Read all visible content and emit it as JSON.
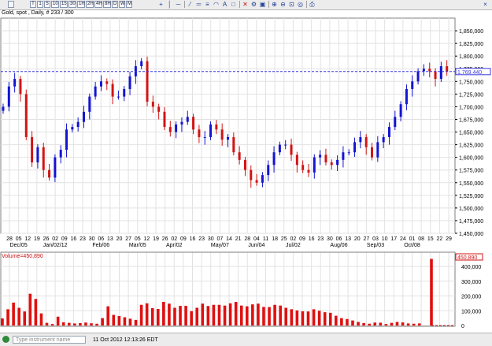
{
  "toolbar": {
    "buttons": [
      "T",
      "1",
      "5",
      "10",
      "15",
      "30",
      "1H",
      "2H",
      "4H",
      "8H",
      "D",
      "W",
      "M"
    ],
    "icons": [
      "crosshair-icon",
      "vertical-line-icon",
      "horizontal-line-icon",
      "trendline-icon",
      "channel-icon",
      "fibonacci-icon",
      "arc-icon",
      "text-icon",
      "rectangle-icon",
      "delete-icon",
      "properties-icon",
      "image-icon",
      "zoom-in-icon",
      "zoom-out-icon",
      "zoom-fit-icon",
      "zoom-reset-icon",
      "print-icon",
      "close-icon"
    ]
  },
  "chart": {
    "title": "Gold, spot , Daily, # 233 / 300",
    "price_label": "1,769.440",
    "volume_label": "Volume=450,890",
    "volume_marker": "450,890"
  },
  "status": {
    "search_placeholder": "Type instrument name",
    "timestamp": "11 Oct 2012 12:13:26 EDT"
  },
  "chart_data": [
    {
      "type": "candlestick",
      "title": "Gold, spot , Daily, # 233 / 300",
      "ylim": [
        1450,
        1875
      ],
      "y_ticks": [
        "1,450,000",
        "1,475,000",
        "1,500,000",
        "1,525,000",
        "1,550,000",
        "1,575,000",
        "1,600,000",
        "1,625,000",
        "1,650,000",
        "1,675,000",
        "1,700,000",
        "1,725,000",
        "1,750,000",
        "1,775,000",
        "1,800,000",
        "1,825,000",
        "1,850,000"
      ],
      "x_ticks": [
        "28",
        "05",
        "12",
        "19",
        "26",
        "02",
        "09",
        "16",
        "23",
        "30",
        "06",
        "13",
        "20",
        "27",
        "05",
        "12",
        "19",
        "26",
        "02",
        "09",
        "16",
        "23",
        "30",
        "07",
        "14",
        "21",
        "28",
        "04",
        "11",
        "18",
        "25",
        "02",
        "09",
        "16",
        "23",
        "30",
        "06",
        "13",
        "20",
        "27",
        "03",
        "10",
        "17",
        "24",
        "01",
        "08",
        "15",
        "22",
        "29"
      ],
      "month_labels": [
        "Dec/05",
        "Jan/02/12",
        "Feb/06",
        "Mar/05",
        "Apr/02",
        "May/07",
        "Jun/04",
        "Jul/02",
        "Aug/06",
        "Sep/03",
        "Oct/08"
      ],
      "reference_line": 1769.44,
      "close_values": [
        1700,
        1740,
        1755,
        1725,
        1640,
        1590,
        1620,
        1575,
        1560,
        1600,
        1615,
        1655,
        1660,
        1670,
        1690,
        1720,
        1740,
        1750,
        1745,
        1720,
        1720,
        1735,
        1760,
        1780,
        1790,
        1710,
        1700,
        1690,
        1660,
        1650,
        1665,
        1670,
        1680,
        1655,
        1640,
        1640,
        1665,
        1655,
        1635,
        1640,
        1610,
        1595,
        1575,
        1555,
        1550,
        1565,
        1585,
        1610,
        1625,
        1625,
        1605,
        1585,
        1575,
        1570,
        1600,
        1605,
        1590,
        1585,
        1595,
        1610,
        1610,
        1630,
        1640,
        1620,
        1600,
        1630,
        1640,
        1660,
        1680,
        1705,
        1735,
        1750,
        1770,
        1775,
        1770,
        1755,
        1780,
        1770
      ],
      "candle_period_days": 2
    },
    {
      "type": "bar",
      "title": "Volume",
      "name": "Volume",
      "ylim": [
        0,
        480000
      ],
      "y_ticks": [
        "0",
        "100,000",
        "200,000",
        "300,000",
        "400,000"
      ],
      "last_value": 450890,
      "values": [
        48000,
        110000,
        155000,
        120000,
        95000,
        215000,
        180000,
        82000,
        18000,
        10000,
        60000,
        22000,
        18000,
        14000,
        16000,
        20000,
        15000,
        12000,
        50000,
        130000,
        72000,
        64000,
        56000,
        46000,
        38000,
        140000,
        150000,
        118000,
        112000,
        160000,
        148000,
        120000,
        133000,
        133000,
        97000,
        120000,
        148000,
        132000,
        140000,
        140000,
        135000,
        150000,
        160000,
        135000,
        130000,
        143000,
        148000,
        126000,
        125000,
        140000,
        135000,
        120000,
        110000,
        102000,
        96000,
        95000,
        110000,
        100000,
        90000,
        86000,
        66000,
        50000,
        44000,
        34000,
        24000,
        16000,
        12000,
        20000,
        19000,
        10000,
        18000,
        24000,
        21000,
        14000,
        12000,
        14000,
        450890
      ]
    }
  ]
}
